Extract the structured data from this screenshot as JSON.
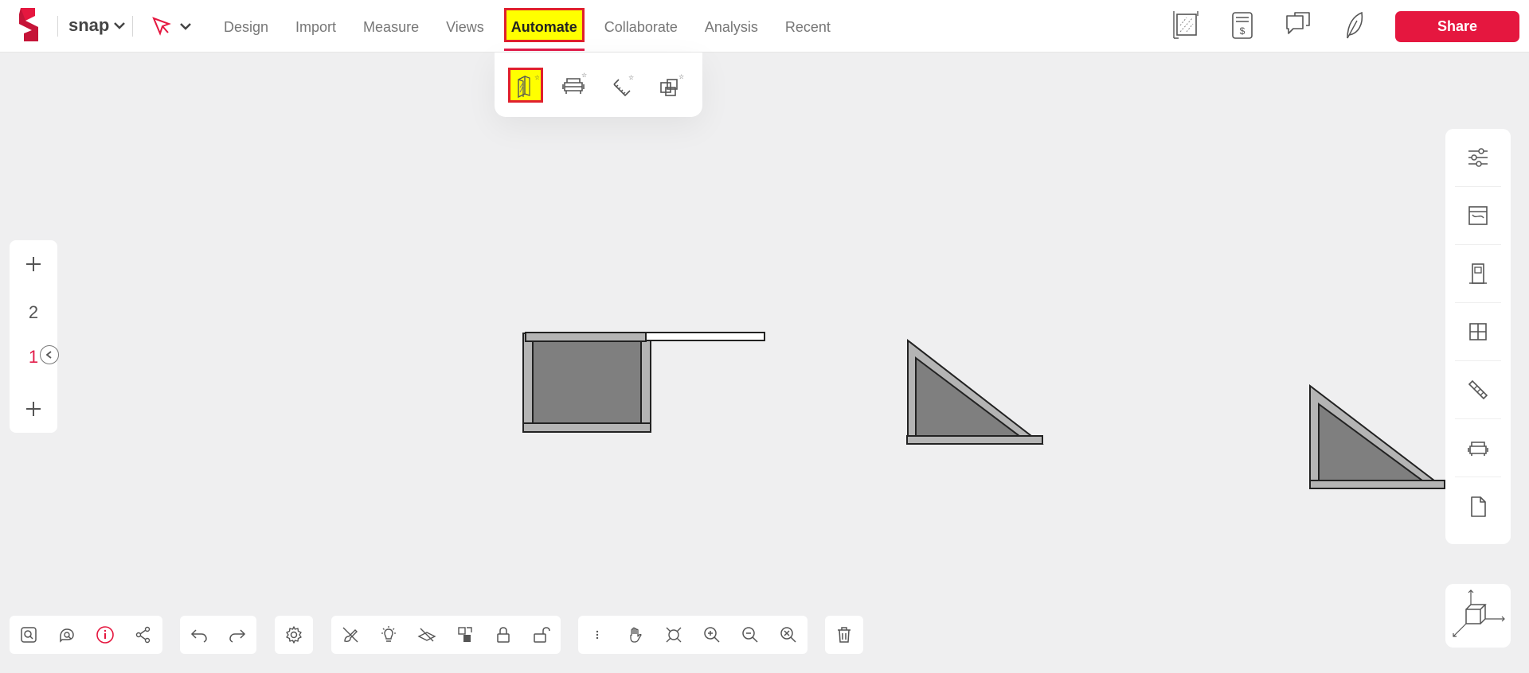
{
  "app": {
    "brand": "snap",
    "logo_icon": "snap-logo-icon",
    "accent_color": "#e5173f"
  },
  "menu": {
    "items": [
      {
        "label": "Design"
      },
      {
        "label": "Import"
      },
      {
        "label": "Measure"
      },
      {
        "label": "Views"
      },
      {
        "label": "Automate"
      },
      {
        "label": "Collaborate"
      },
      {
        "label": "Analysis"
      },
      {
        "label": "Recent"
      }
    ],
    "active": "Automate",
    "highlight_color": "#ffff00"
  },
  "toolbar_right": {
    "icons": [
      "area-measure-icon",
      "cost-estimate-icon",
      "comments-icon",
      "eco-leaf-icon",
      "preview-eye-icon"
    ],
    "share_label": "Share"
  },
  "automate_dropdown": {
    "items": [
      "auto-walls-icon",
      "auto-furnish-icon",
      "auto-dimension-icon",
      "auto-rooms-icon"
    ],
    "selected": "auto-walls-icon"
  },
  "floors": {
    "levels": [
      "2",
      "1"
    ],
    "current": "1"
  },
  "side_panel": {
    "icons": [
      "settings-sliders-icon",
      "materials-icon",
      "door-icon",
      "window-icon",
      "tools-icon",
      "furniture-icon",
      "document-icon"
    ]
  },
  "bottom_toolbar": {
    "group1": [
      "zoom-selection-icon",
      "search-comment-icon",
      "info-icon",
      "share-node-icon"
    ],
    "group2": [
      "undo-icon",
      "redo-icon"
    ],
    "group3": [
      "settings-gear-icon"
    ],
    "group4": [
      "brush-off-icon",
      "light-icon",
      "hide-layer-icon",
      "group-objects-icon",
      "lock-icon",
      "unlock-icon"
    ],
    "group5": [
      "more-vertical-icon",
      "pan-hand-icon",
      "zoom-fit-icon",
      "zoom-in-icon",
      "zoom-out-icon",
      "zoom-reset-icon"
    ],
    "group6": [
      "delete-trash-icon"
    ],
    "info_color": "#e5173f"
  }
}
